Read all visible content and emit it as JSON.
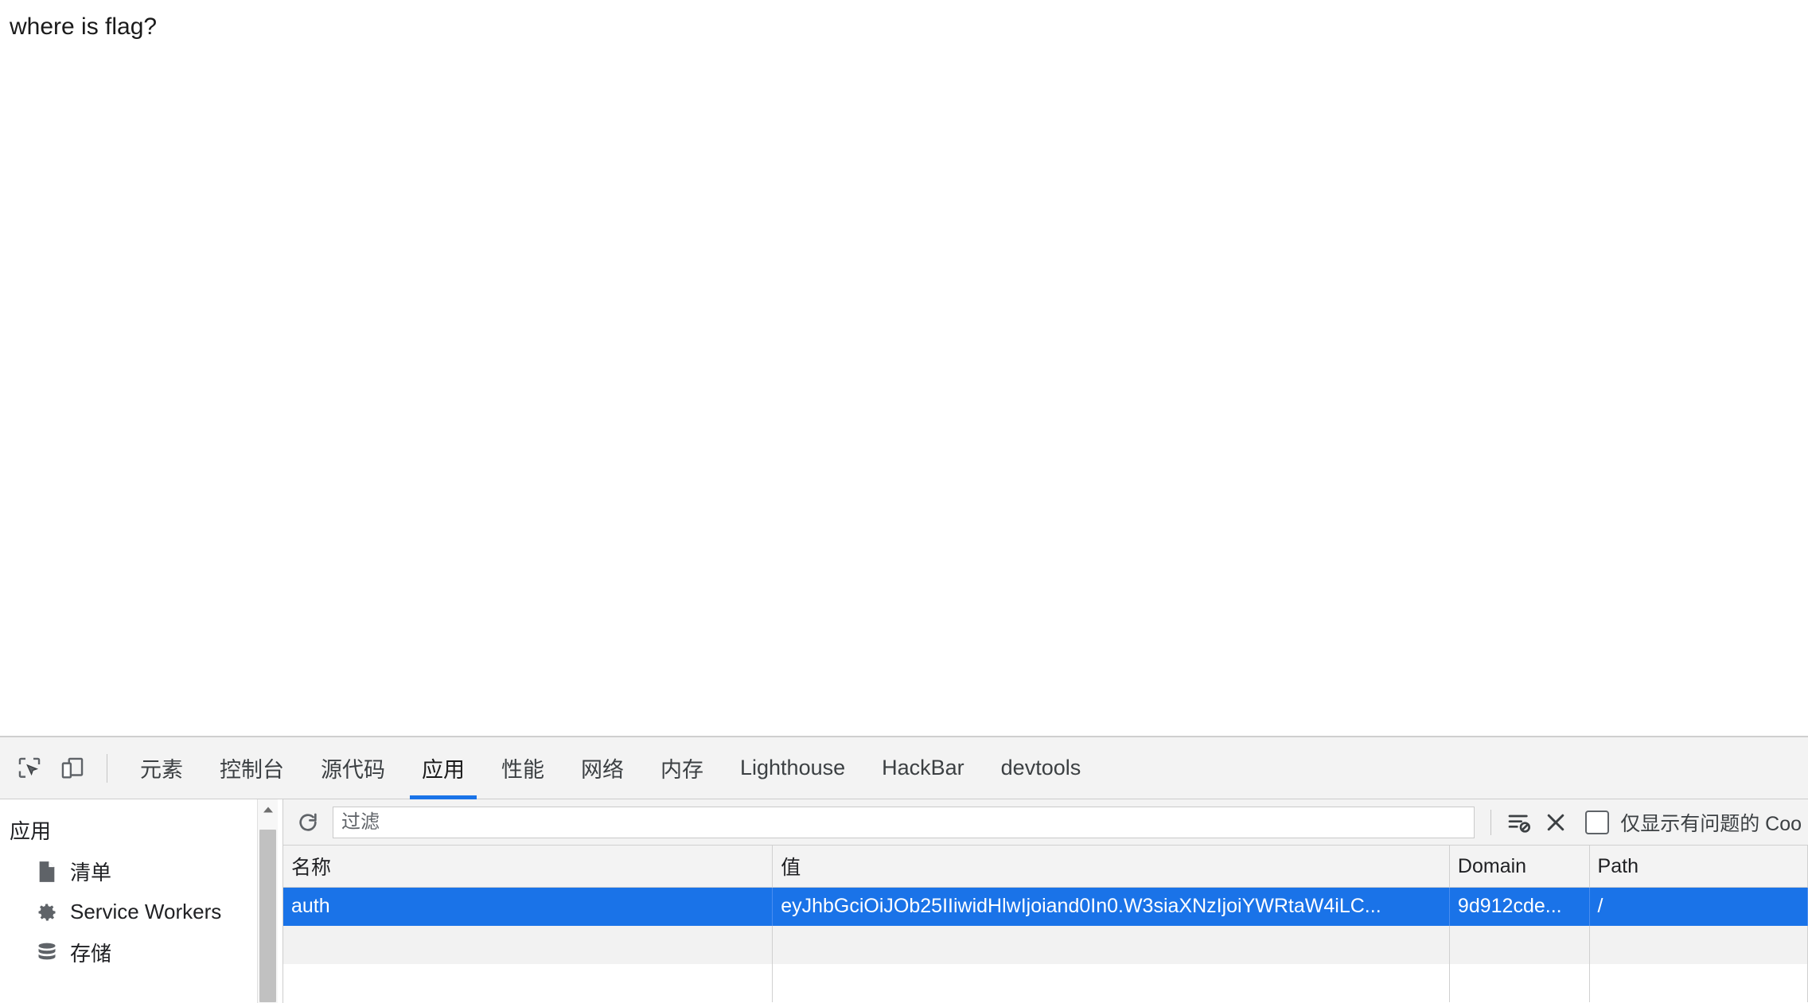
{
  "page": {
    "body_text": "where is flag?"
  },
  "devtools": {
    "toolbar_icons": [
      {
        "name": "inspect-element-icon",
        "title": "inspect"
      },
      {
        "name": "device-toolbar-icon",
        "title": "device toolbar"
      }
    ],
    "tabs": [
      {
        "label": "元素",
        "active": false
      },
      {
        "label": "控制台",
        "active": false
      },
      {
        "label": "源代码",
        "active": false
      },
      {
        "label": "应用",
        "active": true
      },
      {
        "label": "性能",
        "active": false
      },
      {
        "label": "网络",
        "active": false
      },
      {
        "label": "内存",
        "active": false
      },
      {
        "label": "Lighthouse",
        "active": false
      },
      {
        "label": "HackBar",
        "active": false
      },
      {
        "label": "devtools",
        "active": false
      }
    ],
    "accent_color": "#1a73e8"
  },
  "sidebar": {
    "section_title": "应用",
    "items": [
      {
        "label": "清单",
        "icon": "document-icon"
      },
      {
        "label": "Service Workers",
        "icon": "gear-icon"
      },
      {
        "label": "存储",
        "icon": "database-icon"
      }
    ]
  },
  "filterbar": {
    "refresh_label": "",
    "filter_placeholder": "过滤",
    "filter_value": "",
    "clear_filtered_label": "",
    "clear_all_label": "",
    "issues_checkbox_label": "仅显示有问题的 Coo",
    "issues_checkbox_checked": false
  },
  "cookie_table": {
    "columns": [
      "名称",
      "值",
      "Domain",
      "Path"
    ],
    "rows": [
      {
        "selected": true,
        "name": "auth",
        "value": "eyJhbGciOiJOb25IIiwidHlwIjoiand0In0.W3siaXNzIjoiYWRtaW4iLC...",
        "domain": "9d912cde...",
        "path": "/"
      },
      {
        "selected": false,
        "name": "",
        "value": "",
        "domain": "",
        "path": ""
      },
      {
        "selected": false,
        "name": "",
        "value": "",
        "domain": "",
        "path": ""
      }
    ]
  }
}
